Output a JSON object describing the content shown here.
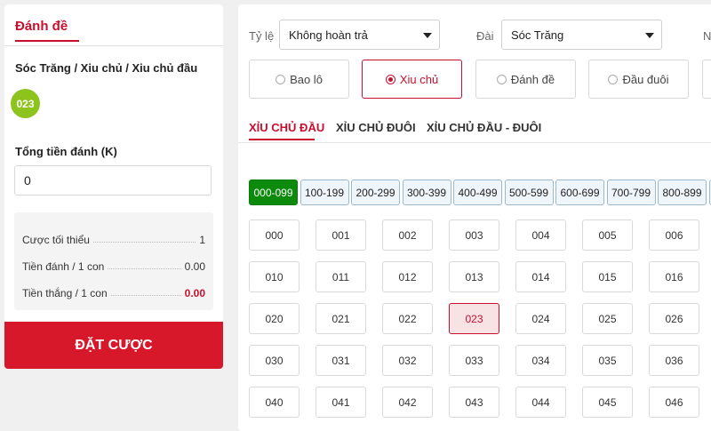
{
  "left_panel": {
    "title": "Đánh đề",
    "selection_label": "Sóc Trăng / Xiu chủ / Xiu chủ đầu",
    "selected_number": "023",
    "amount_label": "Tổng tiền đánh (K)",
    "amount_value": "0",
    "summary": [
      {
        "label": "Cược tối thiểu",
        "value": "1"
      },
      {
        "label": "Tiền đánh / 1 con",
        "value": "0.00"
      },
      {
        "label": "Tiền thắng / 1 con",
        "value": "0.00"
      }
    ],
    "bet_button": "ĐẶT CƯỢC"
  },
  "filters": {
    "ratio_label": "Tỷ lệ",
    "ratio_value": "Không hoàn trả",
    "station_label": "Đài",
    "station_value": "Sóc Trăng",
    "extra_label": "N"
  },
  "bet_types": [
    {
      "label": "Bao lô",
      "active": false
    },
    {
      "label": "Xiu chủ",
      "active": true
    },
    {
      "label": "Đánh đề",
      "active": false
    },
    {
      "label": "Đầu đuôi",
      "active": false
    }
  ],
  "sub_tabs": [
    {
      "label": "XỈU CHỦ ĐẦU",
      "active": true
    },
    {
      "label": "XỈU CHỦ ĐUÔI",
      "active": false
    },
    {
      "label": "XỈU CHỦ ĐẦU - ĐUÔI",
      "active": false
    }
  ],
  "ranges": [
    "000-099",
    "100-199",
    "200-299",
    "300-399",
    "400-499",
    "500-599",
    "600-699",
    "700-799",
    "800-899"
  ],
  "active_range": "000-099",
  "numbers": [
    [
      "000",
      "001",
      "002",
      "003",
      "004",
      "005",
      "006"
    ],
    [
      "010",
      "011",
      "012",
      "013",
      "014",
      "015",
      "016"
    ],
    [
      "020",
      "021",
      "022",
      "023",
      "024",
      "025",
      "026"
    ],
    [
      "030",
      "031",
      "032",
      "033",
      "034",
      "035",
      "036"
    ],
    [
      "040",
      "041",
      "042",
      "043",
      "044",
      "045",
      "046"
    ]
  ],
  "selected_numbers": [
    "023"
  ],
  "colors": {
    "accent": "#c8102e",
    "bet_button": "#d7182a",
    "badge": "#8cc31c",
    "active_range": "#0b8a0b"
  }
}
